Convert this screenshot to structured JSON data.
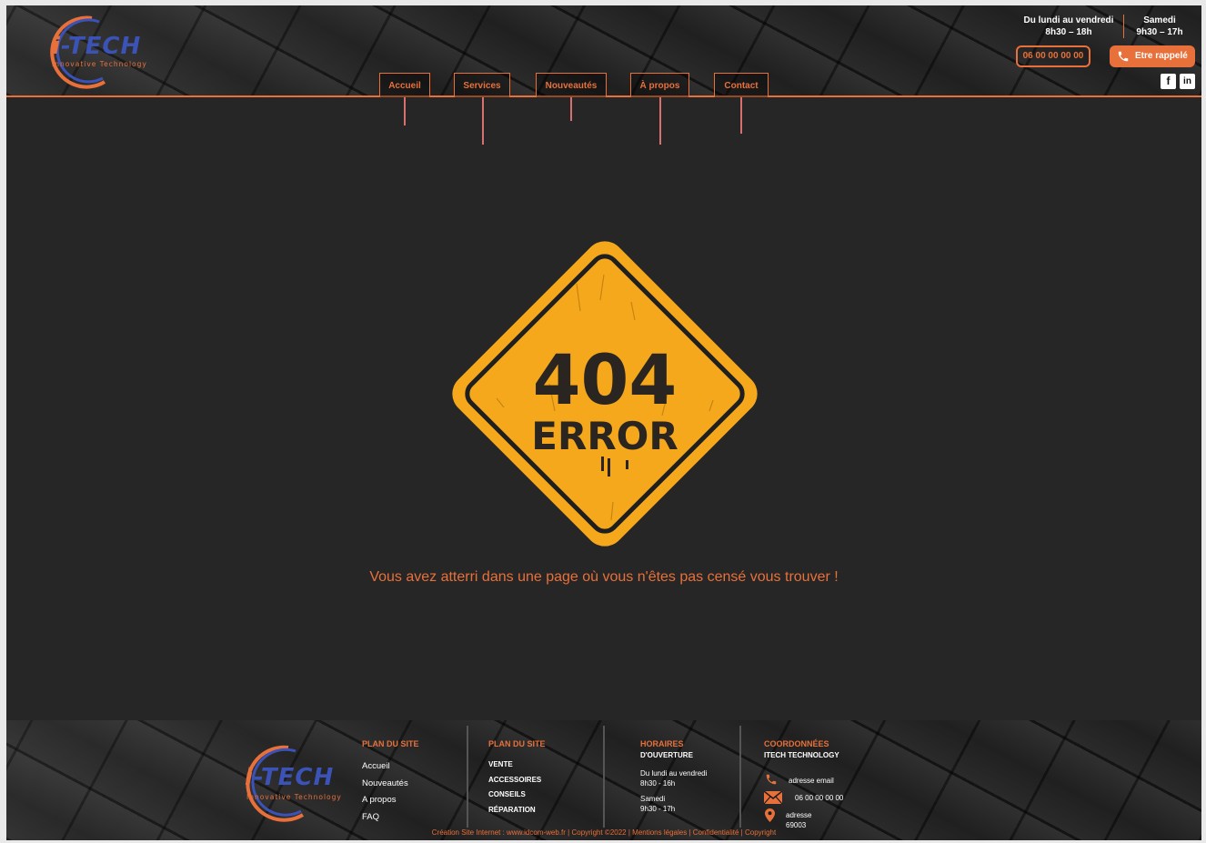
{
  "header": {
    "logo_text_i": "i",
    "logo_text_rest": "-TECH",
    "logo_subtitle": "Innovative Technology",
    "nav": [
      "Accueil",
      "Services",
      "Nouveautés",
      "À propos",
      "Contact"
    ],
    "hours_weekdays_label": "Du lundi au vendredi",
    "hours_weekdays_time": "8h30 – 18h",
    "hours_saturday_label": "Samedi",
    "hours_saturday_time": "9h30 – 17h",
    "phone": "06 00 00 00 00",
    "callback_label": "Etre rappelé",
    "social": [
      "facebook-icon",
      "linkedin-icon"
    ]
  },
  "main": {
    "sign_number": "404",
    "sign_word": "ERROR",
    "message": "Vous avez atterri dans une page où vous n'êtes pas censé vous trouver !"
  },
  "footer": {
    "logo_text_i": "i",
    "logo_text_rest": "-TECH",
    "logo_subtitle": "Innovative Technology",
    "sitemap1": {
      "heading": "PLAN DU SITE",
      "links": [
        "Accueil",
        "Nouveautés",
        "A propos",
        "FAQ"
      ]
    },
    "sitemap2": {
      "heading": "PLAN DU SITE",
      "links": [
        "VENTE",
        "ACCESSOIRES",
        "CONSEILS",
        "RÉPARATION"
      ]
    },
    "hours": {
      "heading": "HORAIRES",
      "subheading": "D'OUVERTURE",
      "weekdays_label": "Du lundi au vendredi",
      "weekdays_time": "8h30 - 16h",
      "saturday_label": "Samedi",
      "saturday_time": "9h30 - 17h"
    },
    "contact": {
      "heading": "COORDONNÉES",
      "subheading": "ITECH TECHNOLOGY",
      "email": "adresse email",
      "phone": "06 00 00 00 00",
      "address_line1": "adresse",
      "address_line2": "69003"
    },
    "copyright": {
      "creation": "Création Site Internet : www.idcom-web.fr",
      "copy": "Copyright ©2022",
      "legal": "Mentions légales",
      "privacy": "Confidentialité",
      "copyright": "Copyright"
    }
  },
  "colors": {
    "accent": "#e8703a",
    "brand_blue": "#3b52b7",
    "sign_yellow": "#f5a81c",
    "background": "#262626"
  }
}
